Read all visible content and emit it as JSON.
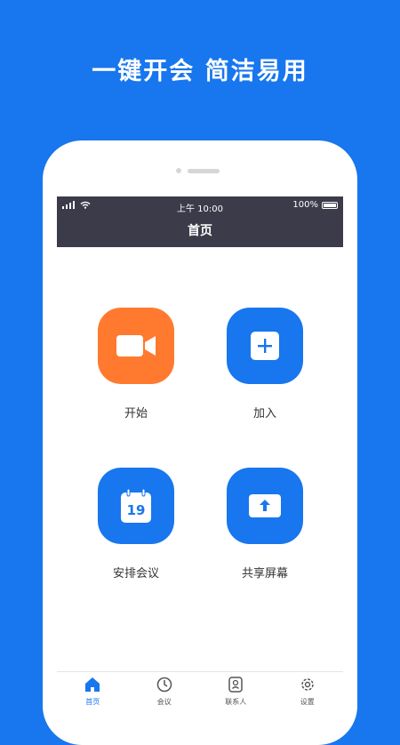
{
  "headline": "一键开会 简洁易用",
  "status": {
    "time": "上午 10:00",
    "battery": "100%"
  },
  "nav": {
    "title": "首页"
  },
  "actions": [
    {
      "label": "开始",
      "icon": "video-camera-icon",
      "color": "#FF7A2F"
    },
    {
      "label": "加入",
      "icon": "plus-icon",
      "color": "#1876EE"
    },
    {
      "label": "安排会议",
      "icon": "calendar-icon",
      "calendar_day": "19",
      "color": "#1876EE"
    },
    {
      "label": "共享屏幕",
      "icon": "share-screen-icon",
      "color": "#1876EE"
    }
  ],
  "tabs": [
    {
      "label": "首页",
      "icon": "home-icon",
      "active": true
    },
    {
      "label": "会议",
      "icon": "clock-icon",
      "active": false
    },
    {
      "label": "联系人",
      "icon": "contacts-icon",
      "active": false
    },
    {
      "label": "设置",
      "icon": "gear-icon",
      "active": false
    }
  ],
  "colors": {
    "brand_blue": "#1876EE",
    "start_orange": "#FF7A2F",
    "dark_bar": "#3b3b4a"
  }
}
